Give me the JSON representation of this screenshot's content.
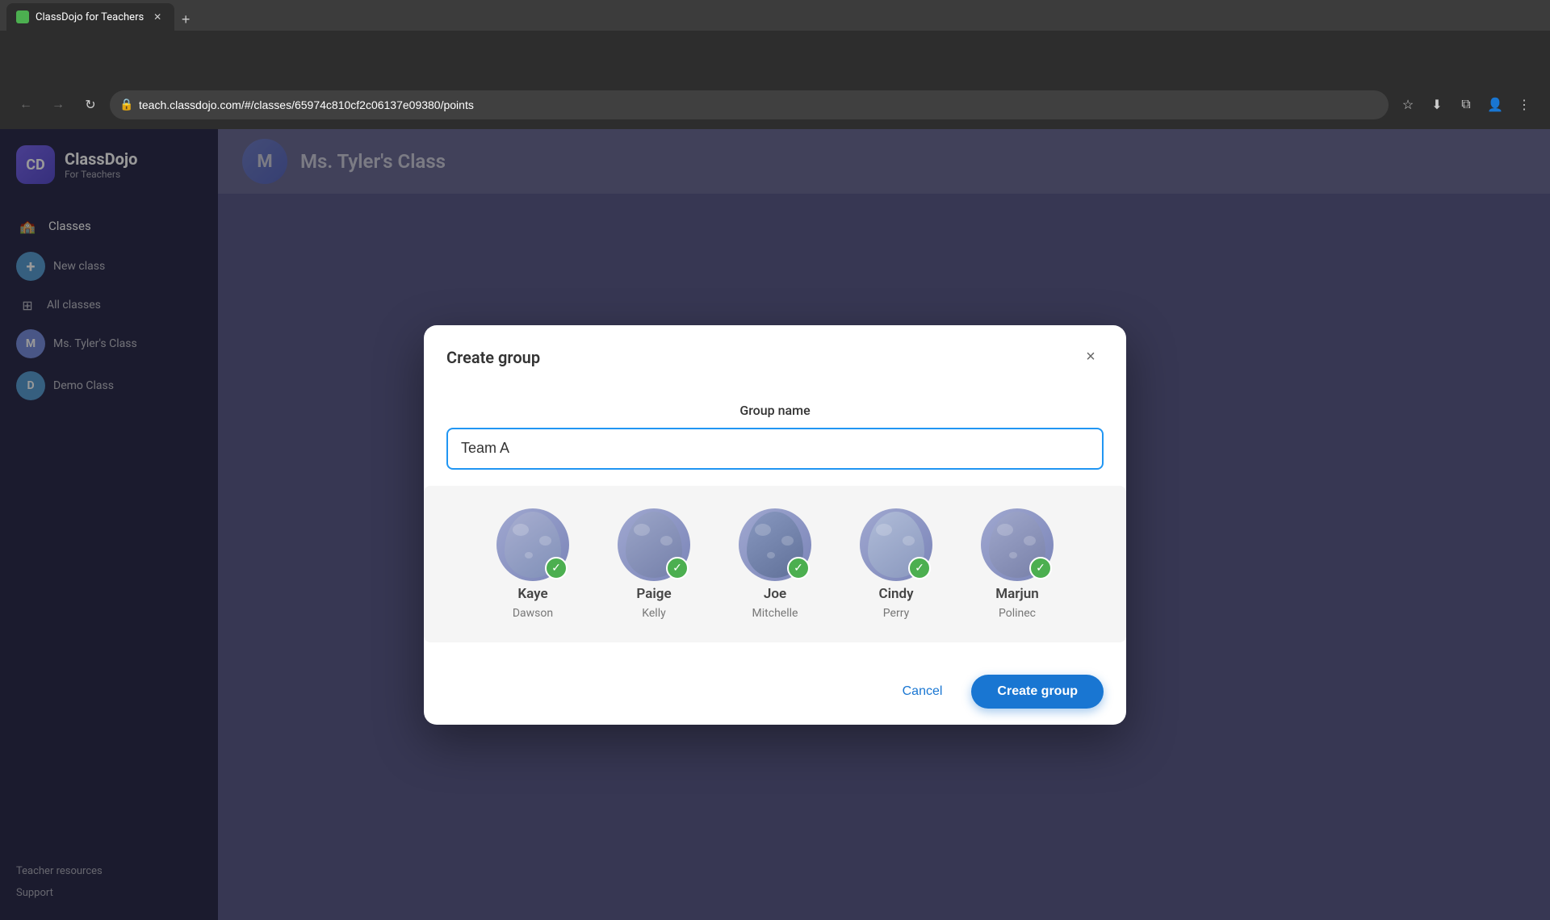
{
  "browser": {
    "tab_title": "ClassDojo for Teachers",
    "url": "teach.classdojo.com/#/classes/65974c810cf2c06137e09380/points",
    "new_tab_label": "+",
    "back_disabled": false,
    "forward_disabled": true
  },
  "sidebar": {
    "brand": "ClassDojo",
    "subtitle": "For Teachers",
    "items": [
      {
        "label": "Classes",
        "icon": "🏫"
      },
      {
        "label": "New class",
        "icon": "+"
      },
      {
        "label": "All classes",
        "icon": "⊞"
      },
      {
        "label": "Ms. Tyler's Class",
        "icon": "M",
        "color": "#7b8fe0"
      },
      {
        "label": "Demo Class",
        "icon": "D",
        "color": "#5a9fd4"
      }
    ],
    "bottom_items": [
      {
        "label": "Teacher resources"
      },
      {
        "label": "Support"
      }
    ]
  },
  "main": {
    "class_title": "Ms. Tyler's Class"
  },
  "modal": {
    "title": "Create group",
    "close_label": "×",
    "group_name_label": "Group name",
    "group_name_value": "Team A",
    "group_name_placeholder": "Team A",
    "cancel_label": "Cancel",
    "create_label": "Create group",
    "members": [
      {
        "first_name": "Kaye",
        "last_name": "Dawson",
        "selected": true
      },
      {
        "first_name": "Paige",
        "last_name": "Kelly",
        "selected": true
      },
      {
        "first_name": "Joe",
        "last_name": "Mitchelle",
        "selected": true
      },
      {
        "first_name": "Cindy",
        "last_name": "Perry",
        "selected": true
      },
      {
        "first_name": "Marjun",
        "last_name": "Polinec",
        "selected": true
      }
    ]
  }
}
